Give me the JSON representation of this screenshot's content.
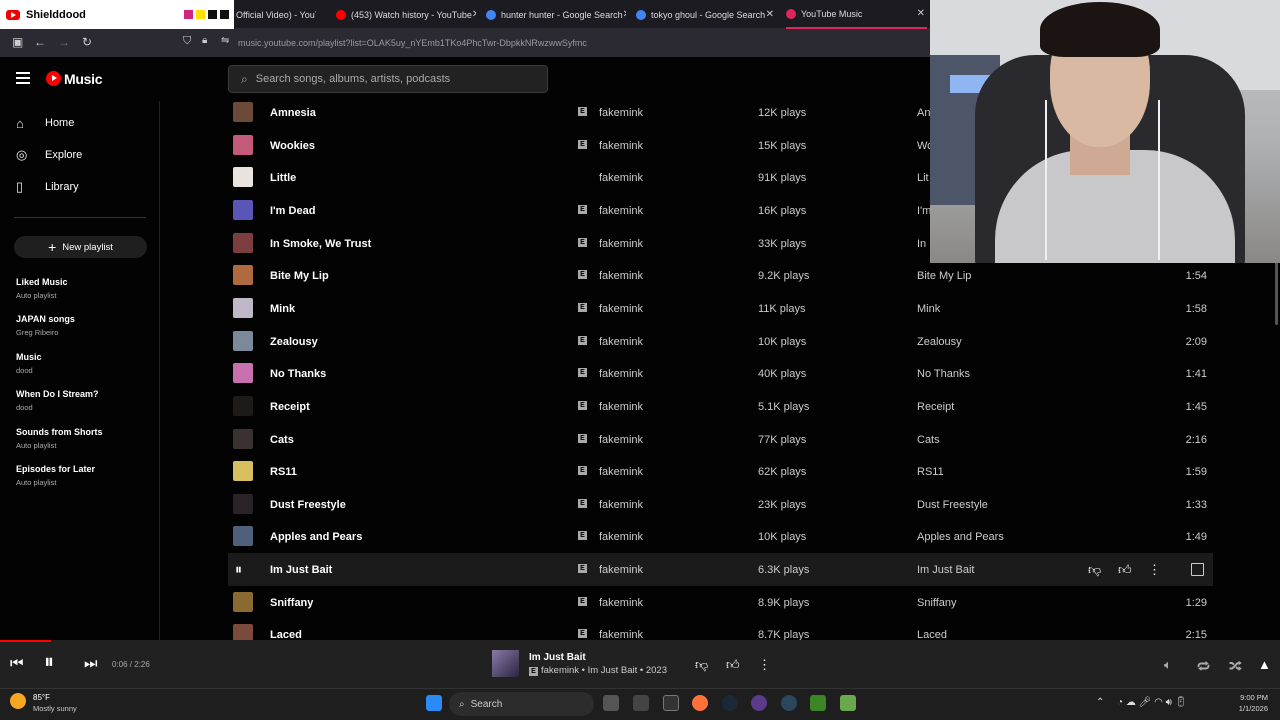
{
  "browser": {
    "shield_label": "Shielddood",
    "tabs": [
      {
        "label": "Official Video) - YouT",
        "color": "#ff0000"
      },
      {
        "label": "(453) Watch history - YouTube",
        "color": "#ff0000"
      },
      {
        "label": "hunter hunter - Google Search",
        "color": "#4285f4"
      },
      {
        "label": "tokyo ghoul - Google Search",
        "color": "#4285f4"
      },
      {
        "label": "YouTube Music",
        "color": "#e0245e"
      }
    ],
    "url": "music.youtube.com/playlist?list=OLAK5uy_nYEmb1TKo4PhcTwr-DbpkkNRwzwwSyfmc"
  },
  "header": {
    "logo_text": "Music",
    "search_placeholder": "Search songs, albums, artists, podcasts"
  },
  "sidebar": {
    "nav": [
      {
        "label": "Home",
        "icon": "home-icon",
        "glyph": "⌂"
      },
      {
        "label": "Explore",
        "icon": "explore-icon",
        "glyph": "◎"
      },
      {
        "label": "Library",
        "icon": "library-icon",
        "glyph": "▯"
      }
    ],
    "new_playlist": "New playlist",
    "playlists": [
      {
        "name": "Liked Music",
        "sub": "Auto playlist"
      },
      {
        "name": "JAPAN songs",
        "sub": "Greg Ribeiro"
      },
      {
        "name": "Music",
        "sub": "dood"
      },
      {
        "name": "When Do I Stream?",
        "sub": "dood"
      },
      {
        "name": "Sounds from Shorts",
        "sub": "Auto playlist"
      },
      {
        "name": "Episodes for Later",
        "sub": "Auto playlist"
      }
    ]
  },
  "tracks": [
    {
      "title": "Amnesia",
      "explicit": true,
      "artist": "fakemink",
      "plays": "12K plays",
      "album": "An",
      "duration": "",
      "color": "#6b4a3a"
    },
    {
      "title": "Wookies",
      "explicit": true,
      "artist": "fakemink",
      "plays": "15K plays",
      "album": "Wo",
      "duration": "",
      "color": "#c45a7a"
    },
    {
      "title": "Little",
      "explicit": false,
      "artist": "fakemink",
      "plays": "91K plays",
      "album": "Lit",
      "duration": "",
      "color": "#e8e3dc"
    },
    {
      "title": "I'm Dead",
      "explicit": true,
      "artist": "fakemink",
      "plays": "16K plays",
      "album": "I'm",
      "duration": "",
      "color": "#5a56b8"
    },
    {
      "title": "In Smoke, We Trust",
      "explicit": true,
      "artist": "fakemink",
      "plays": "33K plays",
      "album": "In",
      "duration": "",
      "color": "#7a3e3e"
    },
    {
      "title": "Bite My Lip",
      "explicit": true,
      "artist": "fakemink",
      "plays": "9.2K plays",
      "album": "Bite My Lip",
      "duration": "1:54",
      "color": "#b06a40"
    },
    {
      "title": "Mink",
      "explicit": true,
      "artist": "fakemink",
      "plays": "11K plays",
      "album": "Mink",
      "duration": "1:58",
      "color": "#c0b8c8"
    },
    {
      "title": "Zealousy",
      "explicit": true,
      "artist": "fakemink",
      "plays": "10K plays",
      "album": "Zealousy",
      "duration": "2:09",
      "color": "#7a8a9a"
    },
    {
      "title": "No Thanks",
      "explicit": true,
      "artist": "fakemink",
      "plays": "40K plays",
      "album": "No Thanks",
      "duration": "1:41",
      "color": "#c870b0"
    },
    {
      "title": "Receipt",
      "explicit": true,
      "artist": "fakemink",
      "plays": "5.1K plays",
      "album": "Receipt",
      "duration": "1:45",
      "color": "#1e1a18"
    },
    {
      "title": "Cats",
      "explicit": true,
      "artist": "fakemink",
      "plays": "77K plays",
      "album": "Cats",
      "duration": "2:16",
      "color": "#3a3230"
    },
    {
      "title": "RS11",
      "explicit": true,
      "artist": "fakemink",
      "plays": "62K plays",
      "album": "RS11",
      "duration": "1:59",
      "color": "#d8c060"
    },
    {
      "title": "Dust Freestyle",
      "explicit": true,
      "artist": "fakemink",
      "plays": "23K plays",
      "album": "Dust Freestyle",
      "duration": "1:33",
      "color": "#2a2428"
    },
    {
      "title": "Apples and Pears",
      "explicit": true,
      "artist": "fakemink",
      "plays": "10K plays",
      "album": "Apples and Pears",
      "duration": "1:49",
      "color": "#50607a"
    },
    {
      "title": "Im Just Bait",
      "explicit": true,
      "artist": "fakemink",
      "plays": "6.3K plays",
      "album": "Im Just Bait",
      "duration": "",
      "color": "#1b1b1b",
      "playing": true
    },
    {
      "title": "Sniffany",
      "explicit": true,
      "artist": "fakemink",
      "plays": "8.9K plays",
      "album": "Sniffany",
      "duration": "1:29",
      "color": "#8a6a30"
    },
    {
      "title": "Laced",
      "explicit": true,
      "artist": "fakemink",
      "plays": "8.7K plays",
      "album": "Laced",
      "duration": "2:15",
      "color": "#7a4a3a"
    }
  ],
  "player": {
    "time": "0:06 / 2:26",
    "progress": 0.04,
    "title": "Im Just Bait",
    "subtitle": "fakemink • Im Just Bait • 2023"
  },
  "taskbar": {
    "temp": "85°F",
    "weather": "Mostly sunny",
    "search": "Search",
    "time": "9:00 PM",
    "date": "1/1/2026"
  }
}
